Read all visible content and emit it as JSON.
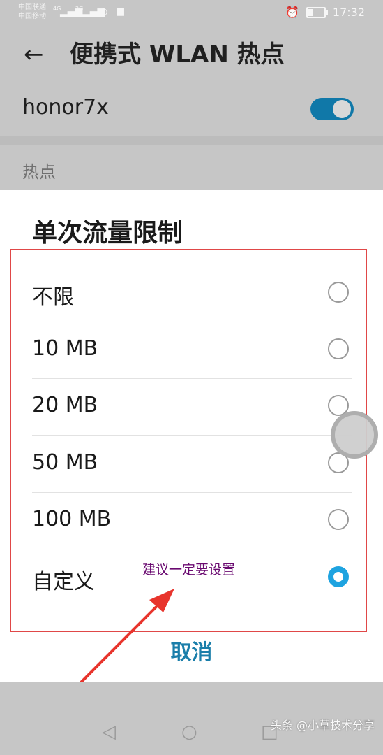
{
  "statusbar": {
    "carrier1": "中国联通",
    "carrier2": "中国移动",
    "net1": "4G",
    "net2": "2G",
    "time": "17:32"
  },
  "appbar": {
    "title": "便携式 WLAN 热点"
  },
  "hotspot": {
    "ssid": "honor7x",
    "enabled": true
  },
  "section": {
    "label": "热点"
  },
  "dialog": {
    "title": "单次流量限制",
    "options": [
      {
        "label": "不限",
        "selected": false
      },
      {
        "label": "10 MB",
        "selected": false
      },
      {
        "label": "20 MB",
        "selected": false
      },
      {
        "label": "50 MB",
        "selected": false
      },
      {
        "label": "100 MB",
        "selected": false
      },
      {
        "label": "自定义",
        "selected": true
      }
    ],
    "cancel_label": "取消"
  },
  "annotation": {
    "text": "建议一定要设置",
    "color": "#6a0a70",
    "box_color": "#e04848"
  },
  "colors": {
    "accent": "#1ea3e0",
    "toggle": "#1078a8",
    "cancel": "#1a7eaa"
  },
  "navbar": {
    "back_icon": "triangle-back-icon",
    "home_icon": "circle-home-icon",
    "recent_icon": "square-recent-icon"
  },
  "watermark": {
    "text": "头条 @小草技术分享"
  }
}
